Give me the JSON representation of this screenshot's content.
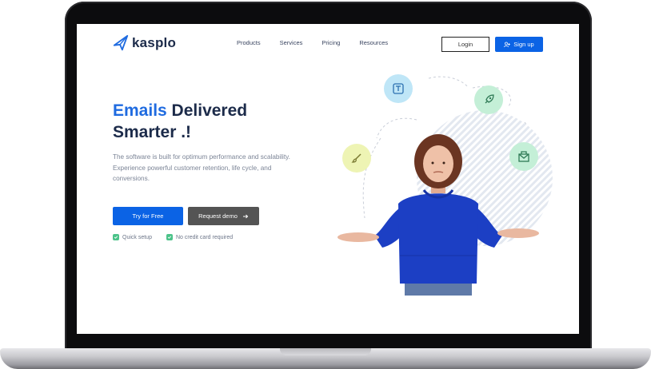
{
  "brand": {
    "name": "kasplo"
  },
  "nav": {
    "items": [
      "Products",
      "Services",
      "Pricing",
      "Resources"
    ]
  },
  "auth": {
    "login_label": "Login",
    "signup_label": "Sign up"
  },
  "hero": {
    "title_accent": "Emails",
    "title_rest": " Delivered",
    "title_line2": "Smarter .!",
    "description": "The software is built for optimum performance and scalability. Experience powerful customer retention, life cycle, and conversions.",
    "primary_cta": "Try for Free",
    "secondary_cta": "Request demo",
    "checks": [
      "Quick setup",
      "No credit card required"
    ]
  },
  "icons": [
    "kasplo-logo-icon",
    "user-plus-icon",
    "arrow-right-icon",
    "check-icon",
    "text-template-icon",
    "rocket-icon",
    "brush-icon",
    "mail-envelope-icon"
  ],
  "colors": {
    "accent": "#0b63e5",
    "title": "#1c2b4a",
    "demo_button": "#545454",
    "check": "#4cc38a",
    "icon_blue": "#bfe6f7",
    "icon_green": "#c4efd7",
    "icon_yellow": "#eef4b4",
    "sweater": "#1c3fc4"
  }
}
